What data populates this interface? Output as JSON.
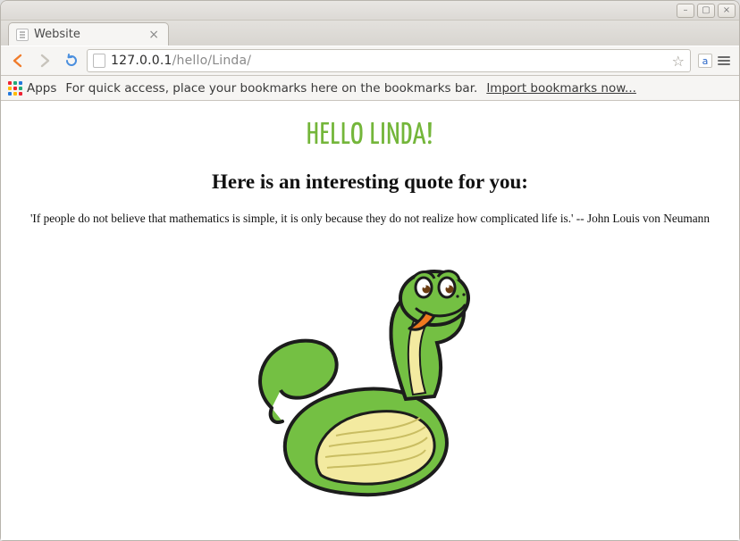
{
  "window": {
    "controls": {
      "minimize": "–",
      "maximize": "▢",
      "close": "×"
    }
  },
  "tab": {
    "title": "Website",
    "close": "×"
  },
  "toolbar": {
    "url_host": "127.0.0.1",
    "url_path": "/hello/Linda/",
    "translate_glyph": "a"
  },
  "bookmarks": {
    "apps_label": "Apps",
    "message": "For quick access, place your bookmarks here on the bookmarks bar.",
    "import_label": "Import bookmarks now..."
  },
  "page": {
    "heading": "Hello Linda!",
    "subheading": "Here is an interesting quote for you:",
    "quote": "'If people do not believe that mathematics is simple, it is only because they do not realize how complicated life is.' -- John Louis von Neumann"
  },
  "colors": {
    "accent_green": "#74b63a"
  }
}
